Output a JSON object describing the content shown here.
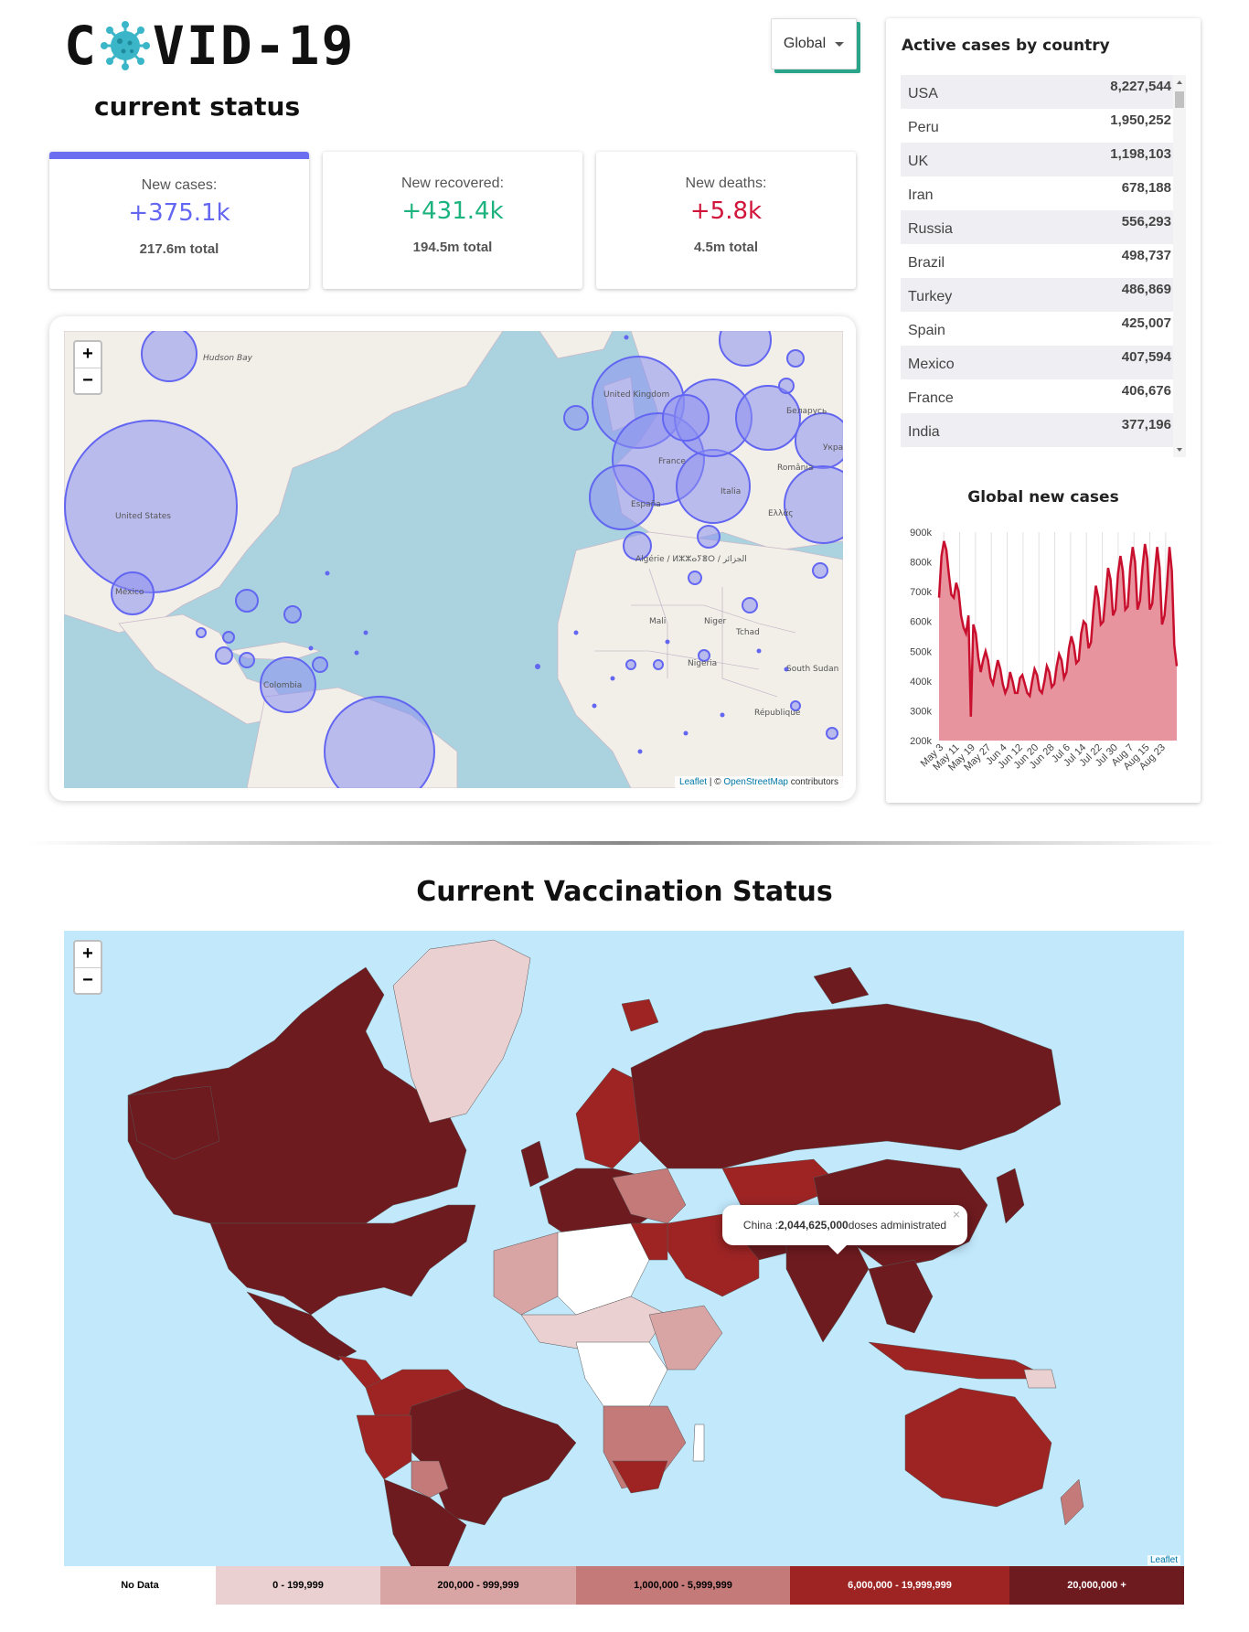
{
  "header": {
    "logo_left": "C",
    "logo_right": "VID-19",
    "subtitle": "current status",
    "region_select": "Global"
  },
  "stats": [
    {
      "label": "New cases:",
      "value": "+375.1k",
      "total": "217.6m total",
      "color": "#6366f1"
    },
    {
      "label": "New recovered:",
      "value": "+431.4k",
      "total": "194.5m total",
      "color": "#1cb37e"
    },
    {
      "label": "New deaths:",
      "value": "+5.8k",
      "total": "4.5m total",
      "color": "#d0143a"
    }
  ],
  "bubble_map": {
    "zoom_in": "+",
    "zoom_out": "−",
    "labels": [
      "United Kingdom",
      "United States",
      "France",
      "España",
      "Italia",
      "México",
      "Colombia",
      "Mali",
      "Niger",
      "Nigeria",
      "Tchad",
      "South Sudan",
      "Hudson Bay",
      "Беларусь",
      "România",
      "Україна",
      "Ελλάς",
      "Algérie / ⵍⵣⵣⴰⵢⴻⵔ / الجزائر",
      "République"
    ],
    "attribution_leaflet": "Leaflet",
    "attribution_sep": " | © ",
    "attribution_osm": "OpenStreetMap",
    "attribution_tail": " contributors",
    "bubble_color": "#6b6ef0",
    "land_color": "#f2efe9",
    "water_color": "#aad3df"
  },
  "active_cases": {
    "title": "Active cases by country",
    "rows": [
      {
        "country": "USA",
        "value": "8,227,544"
      },
      {
        "country": "Peru",
        "value": "1,950,252"
      },
      {
        "country": "UK",
        "value": "1,198,103"
      },
      {
        "country": "Iran",
        "value": "678,188"
      },
      {
        "country": "Russia",
        "value": "556,293"
      },
      {
        "country": "Brazil",
        "value": "498,737"
      },
      {
        "country": "Turkey",
        "value": "486,869"
      },
      {
        "country": "Spain",
        "value": "425,007"
      },
      {
        "country": "Mexico",
        "value": "407,594"
      },
      {
        "country": "France",
        "value": "406,676"
      },
      {
        "country": "India",
        "value": "377,196"
      }
    ]
  },
  "chart_data": {
    "type": "area",
    "title": "Global new cases",
    "xlabel": "",
    "ylabel": "",
    "ylim": [
      200000,
      900000
    ],
    "y_ticks": [
      "200k",
      "300k",
      "400k",
      "500k",
      "600k",
      "700k",
      "800k",
      "900k"
    ],
    "x_tick_labels": [
      "May 3",
      "May 11",
      "May 19",
      "May 27",
      "Jun 4",
      "Jun 12",
      "Jun 20",
      "Jun 28",
      "Jul 6",
      "Jul 14",
      "Jul 22",
      "Jul 30",
      "Aug 7",
      "Aug 15",
      "Aug 23"
    ],
    "series": [
      {
        "values": [
          680000,
          820000,
          870000,
          840000,
          760000,
          690000,
          680000,
          730000,
          700000,
          620000,
          580000,
          560000,
          620000,
          280000,
          590000,
          560000,
          480000,
          430000,
          470000,
          500000,
          470000,
          410000,
          390000,
          430000,
          470000,
          440000,
          390000,
          360000,
          380000,
          430000,
          400000,
          360000,
          360000,
          410000,
          420000,
          390000,
          360000,
          350000,
          400000,
          440000,
          420000,
          370000,
          360000,
          400000,
          450000,
          430000,
          380000,
          390000,
          450000,
          490000,
          470000,
          410000,
          430000,
          510000,
          550000,
          520000,
          460000,
          470000,
          560000,
          600000,
          590000,
          510000,
          530000,
          640000,
          720000,
          680000,
          590000,
          600000,
          690000,
          780000,
          740000,
          620000,
          640000,
          760000,
          820000,
          770000,
          640000,
          650000,
          780000,
          850000,
          800000,
          640000,
          670000,
          780000,
          860000,
          810000,
          640000,
          660000,
          760000,
          850000,
          780000,
          590000,
          620000,
          720000,
          850000,
          770000,
          520000,
          450000
        ]
      }
    ],
    "line_color": "#c8102e",
    "fill_color": "#e8949f"
  },
  "vaccination": {
    "title": "Current Vaccination Status",
    "zoom_in": "+",
    "zoom_out": "−",
    "tooltip_country": "China : ",
    "tooltip_value": "2,044,625,000",
    "tooltip_suffix": " doses administrated",
    "tooltip_close": "×",
    "attribution": "Leaflet",
    "legend": [
      {
        "label": "No Data",
        "color": "#ffffff",
        "text_color": "#000000"
      },
      {
        "label": "0 - 199,999",
        "color": "#ead0d0",
        "text_color": "#000000"
      },
      {
        "label": "200,000 - 999,999",
        "color": "#d9a4a4",
        "text_color": "#000000"
      },
      {
        "label": "1,000,000 - 5,999,999",
        "color": "#c57a7a",
        "text_color": "#000000"
      },
      {
        "label": "6,000,000 - 19,999,999",
        "color": "#9e2424",
        "text_color": "#ffffff"
      },
      {
        "label": "20,000,000 +",
        "color": "#6e1b1f",
        "text_color": "#ffffff"
      }
    ]
  }
}
